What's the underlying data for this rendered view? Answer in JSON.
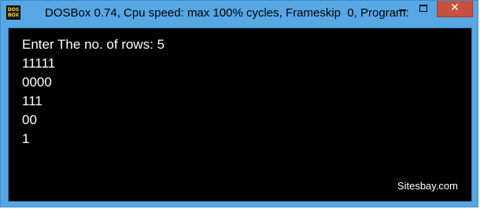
{
  "window": {
    "title": "DOSBox 0.74, Cpu speed: max 100% cycles, Frameskip  0, Program:",
    "icon_text": "DOS BOX",
    "icon": "dosbox-icon",
    "controls": {
      "minimize_icon": "minimize-icon",
      "maximize_icon": "maximize-icon",
      "close_icon": "close-icon",
      "close_glyph": "✕"
    }
  },
  "console": {
    "lines": [
      "Enter The no. of rows: 5",
      "11111",
      "0000",
      "111",
      "00",
      "1"
    ],
    "watermark": "Sitesbay.com",
    "background": "#000000",
    "text_color": "#ffffff"
  },
  "colors": {
    "frame": "#56a7e3",
    "close_button": "#c7503f"
  }
}
